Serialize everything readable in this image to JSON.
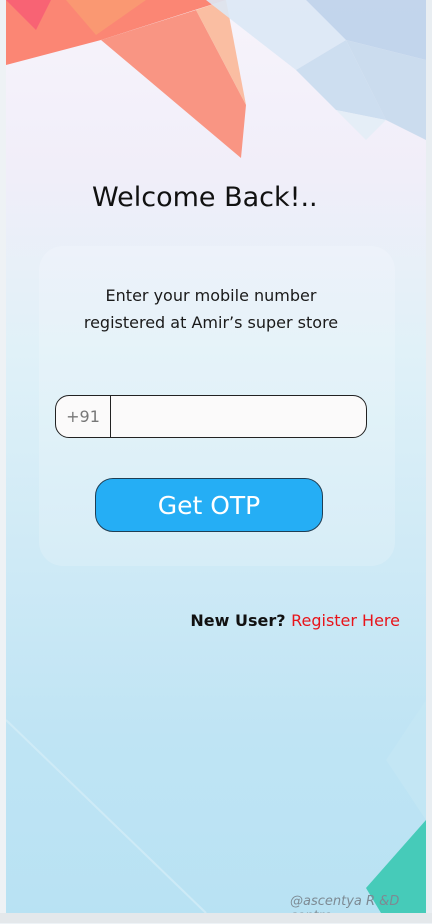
{
  "screen": {
    "welcome_title": "Welcome Back!..",
    "subtitle_line1": "Enter your mobile number",
    "subtitle_line2": "registered at Amir’s super store",
    "phone": {
      "country_code": "+91",
      "value": "",
      "placeholder": ""
    },
    "otp_button_label": "Get OTP",
    "register": {
      "question": "New User?",
      "link_label": "Register Here"
    },
    "watermark": "@ascentya R &D centre"
  },
  "colors": {
    "button": "#25aef5",
    "link": "#e8141a",
    "deco_orange": "#f7836a",
    "deco_blue": "#b9d3ea",
    "deco_teal": "#3fc9b5"
  }
}
